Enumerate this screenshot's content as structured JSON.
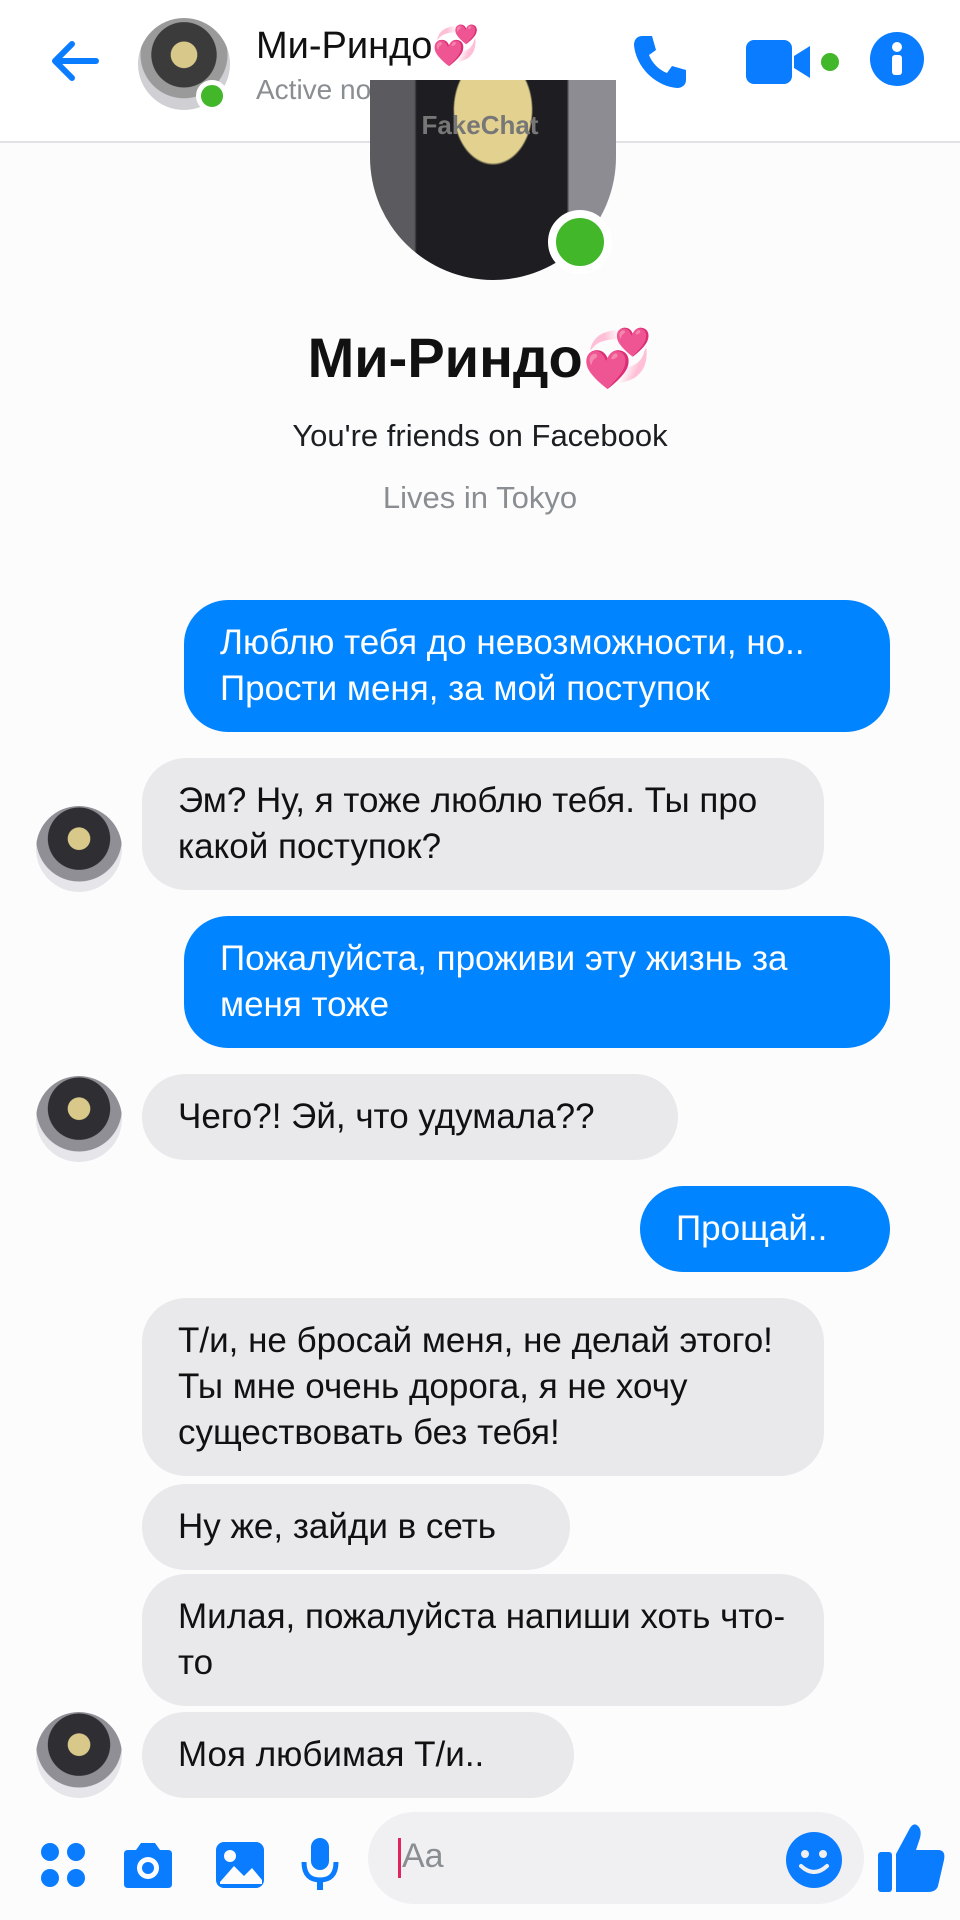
{
  "header": {
    "contact_name": "Ми-Риндо💞",
    "status": "Active now",
    "watermark": "FakeChat"
  },
  "profile": {
    "name": "Ми-Риндо💞",
    "friends_text": "You're friends on Facebook",
    "location": "Lives in Tokyo"
  },
  "messages": [
    {
      "dir": "out",
      "text": "Люблю тебя до невозможности, но.. Прости меня, за мой поступок"
    },
    {
      "dir": "in",
      "text": "Эм? Ну, я тоже люблю тебя. Ты про какой поступок?"
    },
    {
      "dir": "out",
      "text": "Пожалуйста, проживи эту жизнь за меня тоже"
    },
    {
      "dir": "in",
      "text": "Чего?! Эй, что удумала??"
    },
    {
      "dir": "out",
      "text": "Прощай.."
    },
    {
      "dir": "in",
      "text": "Т/и, не бросай меня, не делай этого! Ты мне очень дорога, я не хочу существовать без тебя!"
    },
    {
      "dir": "in",
      "text": "Ну же, зайди в сеть"
    },
    {
      "dir": "in",
      "text": "Милая, пожалуйста напиши хоть что-то"
    },
    {
      "dir": "in",
      "text": "Моя любимая Т/и.."
    }
  ],
  "composer": {
    "placeholder": "Aa"
  },
  "colors": {
    "accent": "#0084ff",
    "online": "#42b72a",
    "incoming_bubble": "#e9e9ec"
  },
  "icons": [
    "back-arrow-icon",
    "phone-icon",
    "video-camera-icon",
    "info-icon",
    "apps-grid-icon",
    "camera-icon",
    "image-icon",
    "microphone-icon",
    "emoji-icon",
    "thumbs-up-icon"
  ]
}
